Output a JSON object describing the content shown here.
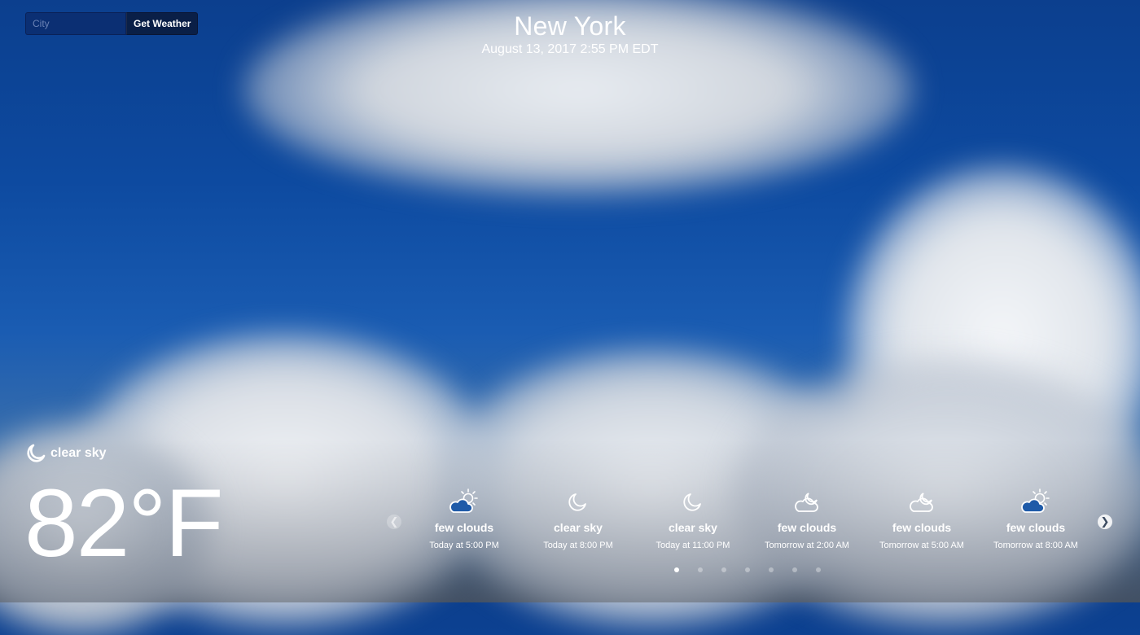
{
  "search": {
    "placeholder": "City",
    "value": "",
    "button_label": "Get Weather"
  },
  "header": {
    "city": "New York",
    "datetime": "August 13, 2017 2:55 PM EDT"
  },
  "current": {
    "condition": "clear sky",
    "condition_icon": "moon-icon",
    "temperature": "82°F"
  },
  "forecast": [
    {
      "description": "few clouds",
      "time": "Today at 5:00 PM",
      "icon": "sun-cloud-icon"
    },
    {
      "description": "clear sky",
      "time": "Today at 8:00 PM",
      "icon": "moon-icon"
    },
    {
      "description": "clear sky",
      "time": "Today at 11:00 PM",
      "icon": "moon-icon"
    },
    {
      "description": "few clouds",
      "time": "Tomorrow at 2:00 AM",
      "icon": "moon-cloud-icon"
    },
    {
      "description": "few clouds",
      "time": "Tomorrow at 5:00 AM",
      "icon": "moon-cloud-icon"
    },
    {
      "description": "few clouds",
      "time": "Tomorrow at 8:00 AM",
      "icon": "sun-cloud-icon"
    }
  ],
  "carousel": {
    "page_count": 7,
    "active_page": 1
  }
}
